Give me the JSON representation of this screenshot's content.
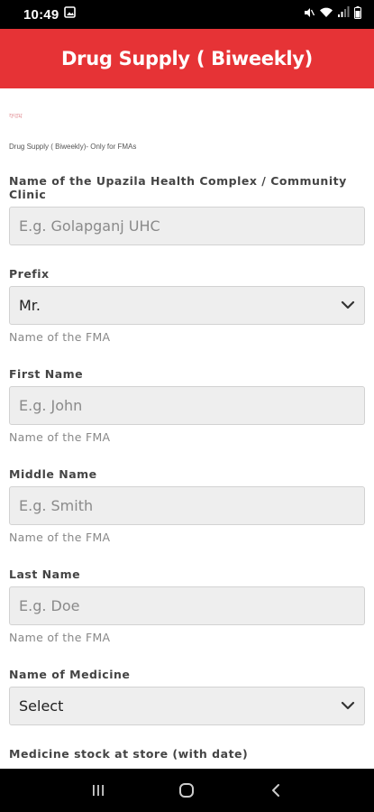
{
  "status_bar": {
    "time": "10:49",
    "icons": [
      "image-icon",
      "mute-icon",
      "wifi-icon",
      "signal-icon",
      "battery-icon"
    ]
  },
  "header": {
    "title": "Drug Supply ( Biweekly)",
    "color": "#e63336"
  },
  "form": {
    "tiny_red_text": "ফরম",
    "description": "Drug Supply ( Biweekly)- Only for FMAs",
    "fields": [
      {
        "label": "Name of the Upazila Health Complex / Community Clinic",
        "placeholder": "E.g. Golapganj UHC"
      },
      {
        "label": "Prefix",
        "value": "Mr.",
        "hint": "Name of the FMA"
      },
      {
        "label": "First Name",
        "placeholder": "E.g. John",
        "hint": "Name of the FMA"
      },
      {
        "label": "Middle Name",
        "placeholder": "E.g. Smith",
        "hint": "Name of the FMA"
      },
      {
        "label": "Last Name",
        "placeholder": "E.g. Doe",
        "hint": "Name of the FMA"
      },
      {
        "label": "Name of Medicine",
        "value": "Select"
      },
      {
        "label": "Medicine stock at store (with date)"
      }
    ]
  },
  "nav_bar": {
    "buttons": [
      "recents-icon",
      "home-icon",
      "back-icon"
    ]
  }
}
